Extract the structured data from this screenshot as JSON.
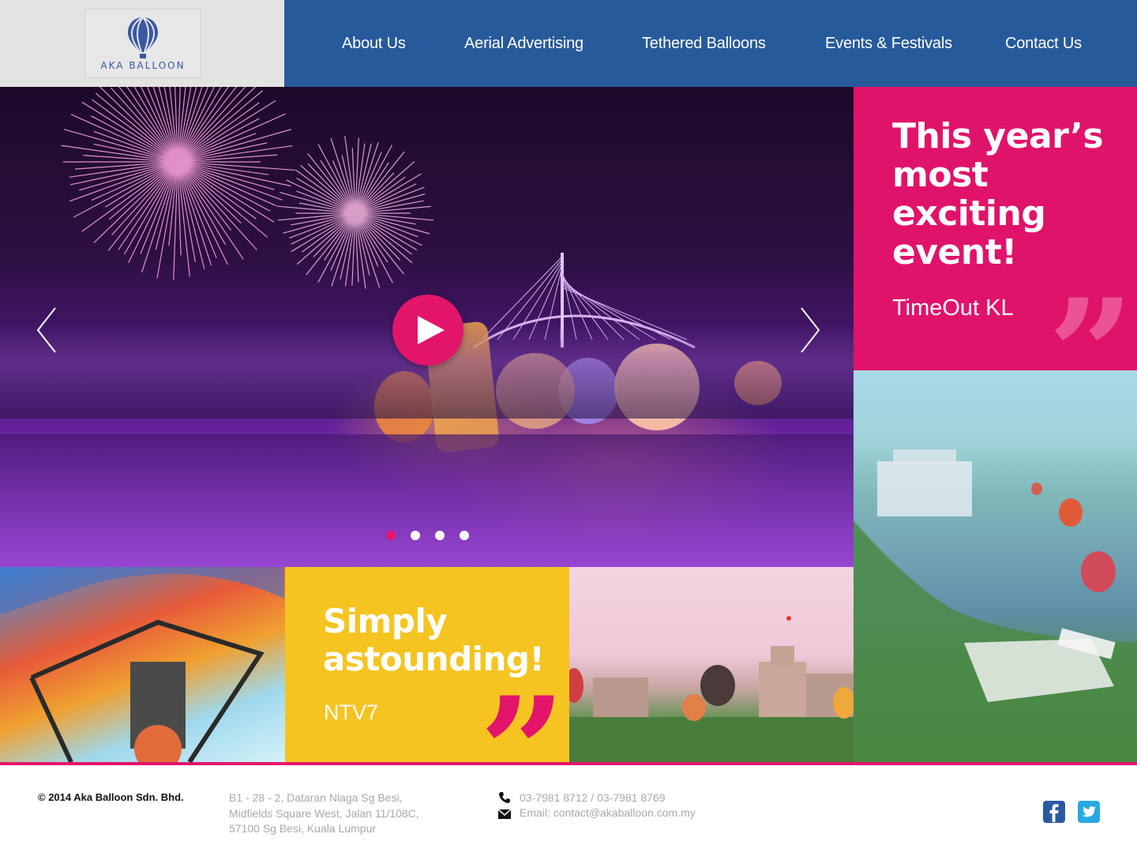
{
  "header": {
    "logo_text": "AKA BALLOON",
    "nav": [
      "About Us",
      "Aerial Advertising",
      "Tethered Balloons",
      "Events & Festivals",
      "Contact Us"
    ]
  },
  "hero": {
    "slide_count": 4,
    "active_slide": 1
  },
  "quotes": {
    "pink": {
      "text": "This year’s most exciting event!",
      "source": "TimeOut KL",
      "mark": "”"
    },
    "yellow": {
      "text": "Simply astounding!",
      "source": "NTV7",
      "mark": "”"
    }
  },
  "footer": {
    "copyright": "© 2014 Aka Balloon Sdn. Bhd.",
    "address": [
      "B1 - 28 - 2, Dataran Niaga Sg Besi,",
      "Midfields Square West, Jalan 11/108C,",
      "57100 Sg Besi, Kuala Lumpur"
    ],
    "phone": "03-7981 8712 / 03-7981 8769",
    "email": "Email: contact@akaballoon.com.my"
  },
  "colors": {
    "nav_blue": "#265a9a",
    "accent_pink": "#e2156b",
    "accent_yellow": "#f5c421",
    "facebook_blue": "#2c5aa0",
    "twitter_blue": "#29a9e0"
  },
  "icons": [
    "balloon-logo-icon",
    "chevron-left-icon",
    "chevron-right-icon",
    "play-icon",
    "phone-icon",
    "envelope-icon",
    "facebook-icon",
    "twitter-icon"
  ]
}
